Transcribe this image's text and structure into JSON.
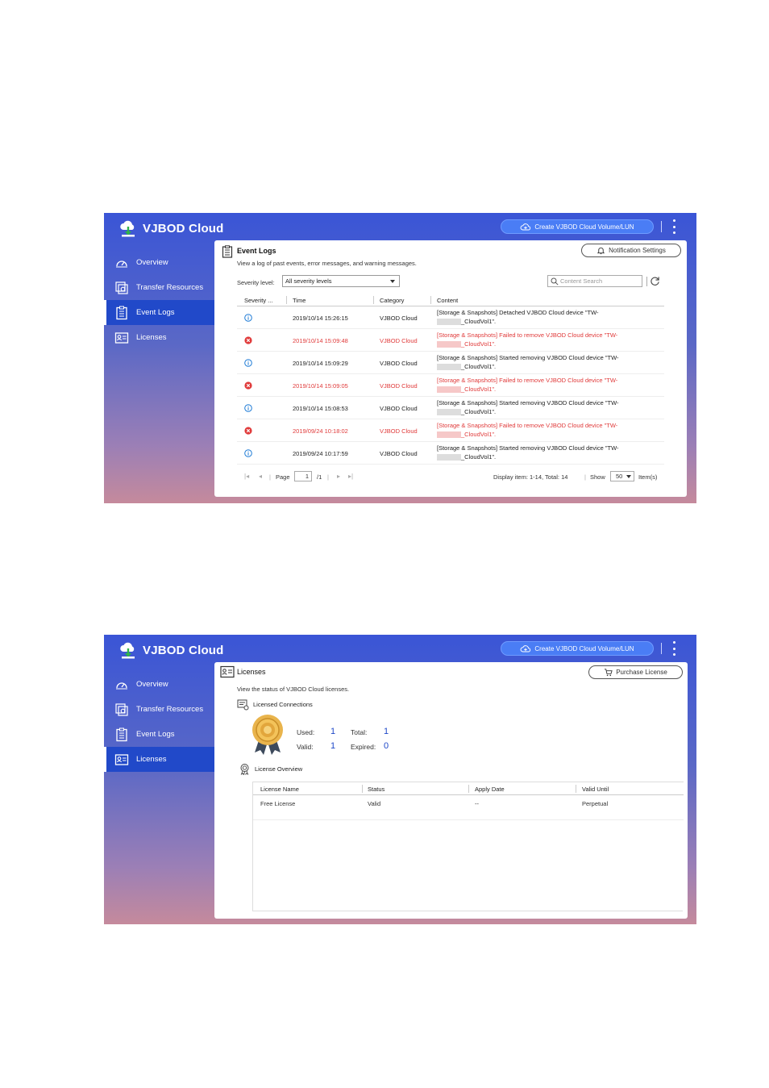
{
  "app": {
    "name": "VJBOD Cloud",
    "create_btn": "Create VJBOD Cloud Volume/LUN"
  },
  "nav": [
    "Overview",
    "Transfer Resources",
    "Event Logs",
    "Licenses"
  ],
  "event_logs": {
    "title": "Event Logs",
    "description": "View a log of past events, error messages, and warning messages.",
    "notification_btn": "Notification Settings",
    "severity_label": "Severity level:",
    "severity_value": "All severity levels",
    "search_placeholder": "Content Search",
    "columns": [
      "Severity ...",
      "Time",
      "Category",
      "Content"
    ],
    "rows": [
      {
        "severity": "info",
        "time": "2019/10/14 15:26:15",
        "category": "VJBOD Cloud",
        "line1": "[Storage & Snapshots] Detached VJBOD Cloud device \"TW-",
        "line2": "_CloudVol1\"."
      },
      {
        "severity": "error",
        "time": "2019/10/14 15:09:48",
        "category": "VJBOD Cloud",
        "line1": "[Storage & Snapshots] Failed to remove VJBOD Cloud device \"TW-",
        "line2": "_CloudVol1\"."
      },
      {
        "severity": "info",
        "time": "2019/10/14 15:09:29",
        "category": "VJBOD Cloud",
        "line1": "[Storage & Snapshots] Started removing VJBOD Cloud device \"TW-",
        "line2": "_CloudVol1\"."
      },
      {
        "severity": "error",
        "time": "2019/10/14 15:09:05",
        "category": "VJBOD Cloud",
        "line1": "[Storage & Snapshots] Failed to remove VJBOD Cloud device \"TW-",
        "line2": "_CloudVol1\"."
      },
      {
        "severity": "info",
        "time": "2019/10/14 15:08:53",
        "category": "VJBOD Cloud",
        "line1": "[Storage & Snapshots] Started removing VJBOD Cloud device \"TW-",
        "line2": "_CloudVol1\"."
      },
      {
        "severity": "error",
        "time": "2019/09/24 10:18:02",
        "category": "VJBOD Cloud",
        "line1": "[Storage & Snapshots] Failed to remove VJBOD Cloud device \"TW-",
        "line2": "_CloudVol1\"."
      },
      {
        "severity": "info",
        "time": "2019/09/24 10:17:59",
        "category": "VJBOD Cloud",
        "line1": "[Storage & Snapshots] Started removing VJBOD Cloud device \"TW-",
        "line2": "_CloudVol1\"."
      }
    ],
    "pager": {
      "page_label": "Page",
      "page": "1",
      "of": "/1",
      "display": "Display item: 1-14, Total: 14",
      "show_label": "Show",
      "show_value": "50",
      "items_label": "Item(s)"
    }
  },
  "licenses": {
    "title": "Licenses",
    "purchase_btn": "Purchase License",
    "description": "View the status of VJBOD Cloud licenses.",
    "connections_title": "Licensed Connections",
    "used_label": "Used:",
    "used": "1",
    "total_label": "Total:",
    "total": "1",
    "valid_label": "Valid:",
    "valid": "1",
    "expired_label": "Expired:",
    "expired": "0",
    "overview_title": "License Overview",
    "columns": [
      "License Name",
      "Status",
      "Apply Date",
      "Valid Until"
    ],
    "row": {
      "name": "Free License",
      "status": "Valid",
      "apply": "--",
      "until": "Perpetual"
    }
  },
  "colors": {
    "accent": "#2149c9",
    "error": "#e03a3a",
    "info": "#1e7bd6",
    "button": "#4a7df5"
  }
}
